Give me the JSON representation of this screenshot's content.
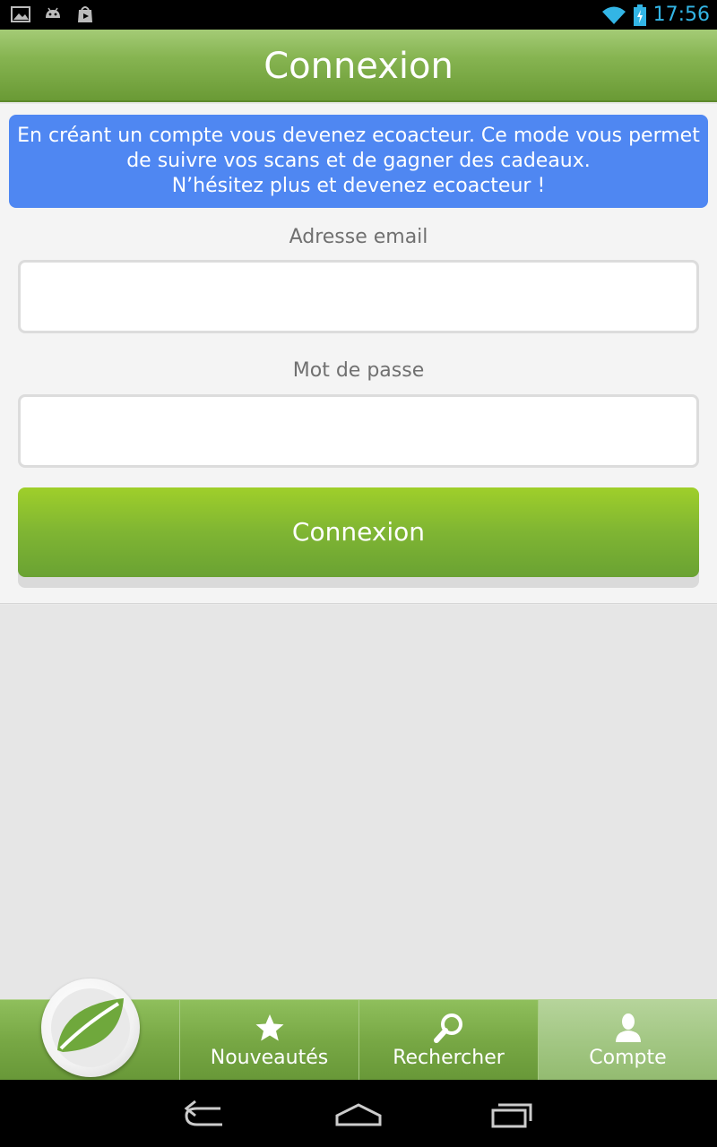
{
  "statusbar": {
    "time": "17:56"
  },
  "header": {
    "title": "Connexion"
  },
  "info": {
    "line1": "En créant un compte vous devenez ecoacteur. Ce mode vous permet",
    "line2": "de suivre vos scans et de gagner des cadeaux.",
    "line3": "N’hésitez plus et devenez ecoacteur !"
  },
  "form": {
    "email_label": "Adresse email",
    "email_value": "",
    "password_label": "Mot de passe",
    "password_value": "",
    "submit_label": "Connexion"
  },
  "tabs": [
    {
      "label": "Nouveautés",
      "icon": "star-icon"
    },
    {
      "label": "Rechercher",
      "icon": "search-icon"
    },
    {
      "label": "Compte",
      "icon": "user-icon"
    }
  ],
  "colors": {
    "accent_green": "#7fb533",
    "info_blue": "#4f87f2",
    "status_time": "#33b5e5"
  }
}
